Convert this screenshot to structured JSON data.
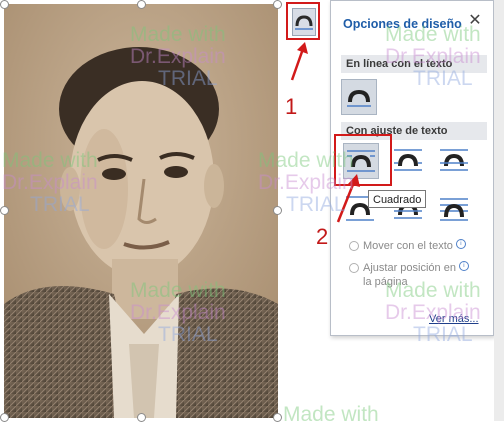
{
  "panel": {
    "title": "Opciones de diseño",
    "close_icon": "close-icon",
    "section_inline": "En línea con el texto",
    "section_wrap": "Con ajuste de texto",
    "tooltip": "Cuadrado",
    "move_with_text": "Mover con el texto",
    "fix_position_line1": "Ajustar posición en",
    "fix_position_line2": "la página",
    "see_more": "Ver más..."
  },
  "annotations": {
    "step1": "1",
    "step2": "2",
    "color": "#d21a1a"
  },
  "watermark": {
    "line1": "Made with",
    "line2": "Dr.Explain",
    "line3": "TRIAL"
  },
  "colors": {
    "accent": "#1f5da8",
    "selected_bg": "#d4dae2"
  }
}
